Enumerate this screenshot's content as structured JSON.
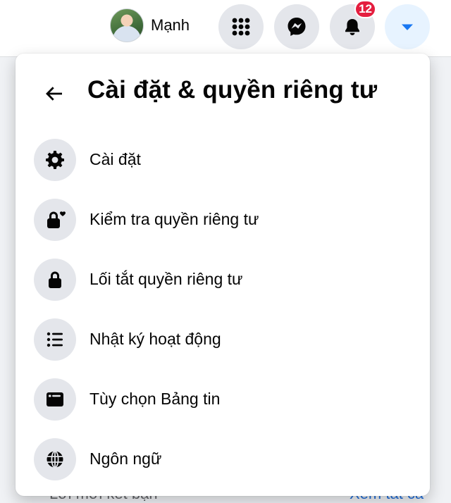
{
  "topbar": {
    "profile_name": "Mạnh",
    "notification_count": "12"
  },
  "background": {
    "hint_text": "Lời mời kết bạn",
    "hint_link": "Xem tất cả"
  },
  "panel": {
    "title": "Cài đặt & quyền riêng tư",
    "items": [
      {
        "label": "Cài đặt",
        "icon": "gear-icon"
      },
      {
        "label": "Kiểm tra quyền riêng tư",
        "icon": "lock-heart-icon"
      },
      {
        "label": "Lối tắt quyền riêng tư",
        "icon": "lock-icon"
      },
      {
        "label": "Nhật ký hoạt động",
        "icon": "list-icon"
      },
      {
        "label": "Tùy chọn Bảng tin",
        "icon": "news-feed-icon"
      },
      {
        "label": "Ngôn ngữ",
        "icon": "globe-icon"
      }
    ]
  },
  "colors": {
    "accent": "#1877f2",
    "badge": "#e41e3f",
    "icon_bg": "#e4e6eb"
  }
}
